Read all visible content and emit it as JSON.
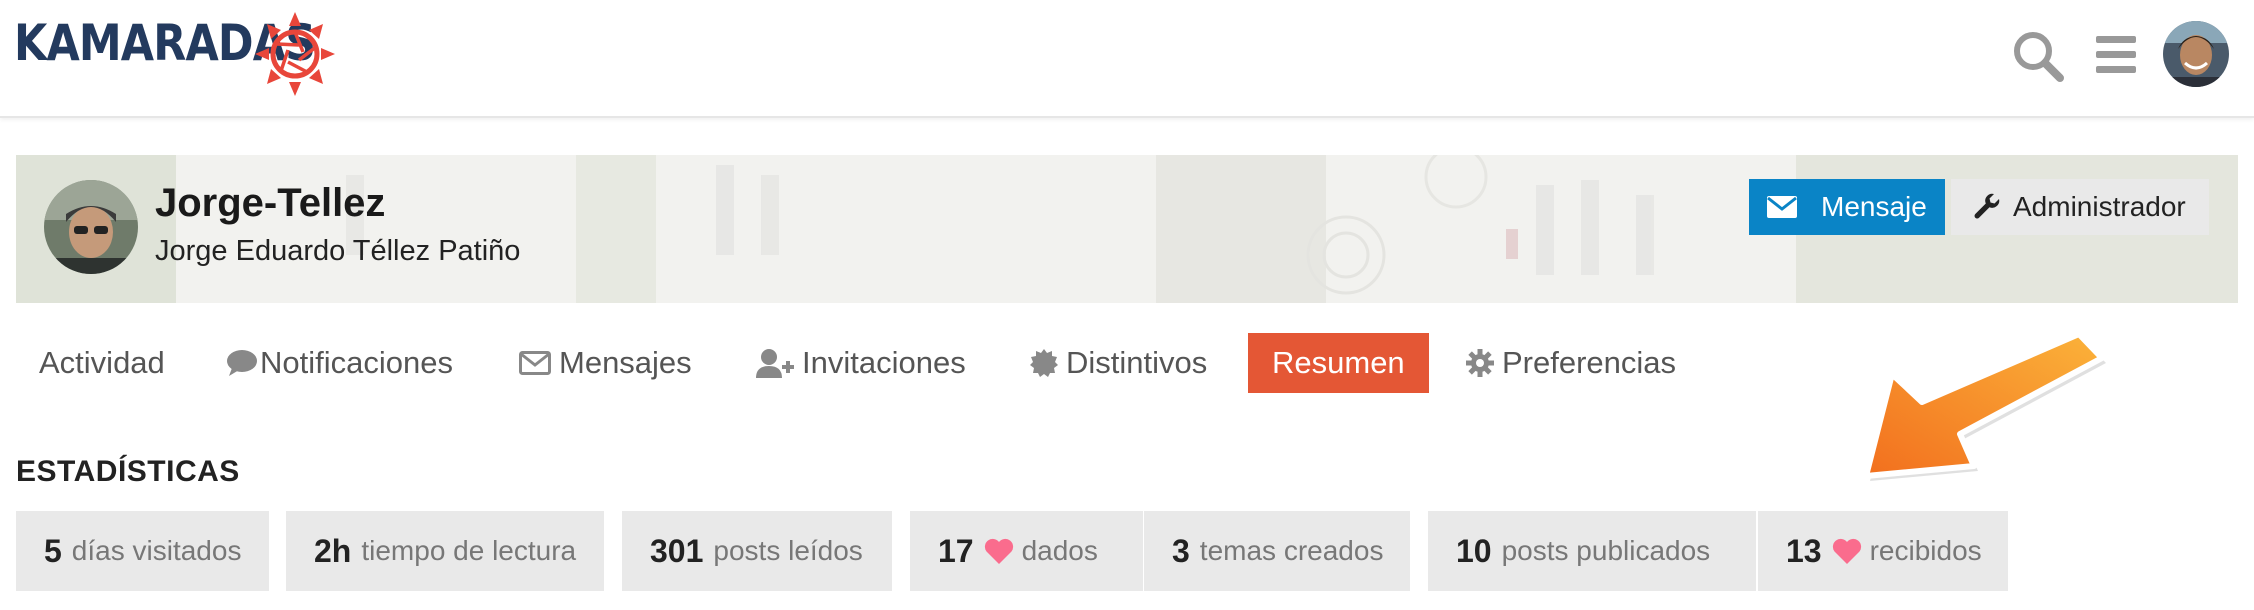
{
  "header": {
    "logo_text": "KAMARADAS",
    "icons": [
      "search-icon",
      "hamburger-menu-icon",
      "user-avatar"
    ]
  },
  "profile": {
    "username": "Jorge-Tellez",
    "full_name": "Jorge Eduardo Téllez Patiño",
    "message_button": "Mensaje",
    "admin_button": "Administrador"
  },
  "nav": {
    "items": [
      {
        "label": "Actividad",
        "icon": ""
      },
      {
        "label": "Notificaciones",
        "icon": "comment-icon"
      },
      {
        "label": "Mensajes",
        "icon": "envelope-icon"
      },
      {
        "label": "Invitaciones",
        "icon": "user-plus-icon"
      },
      {
        "label": "Distintivos",
        "icon": "badge-icon"
      },
      {
        "label": "Resumen",
        "icon": "",
        "active": true
      },
      {
        "label": "Preferencias",
        "icon": "gear-icon"
      }
    ]
  },
  "stats": {
    "title": "ESTADÍSTICAS",
    "items": [
      {
        "value": "5",
        "label": "días visitados"
      },
      {
        "value": "2h",
        "label": "tiempo de lectura"
      },
      {
        "value": "301",
        "label": "posts leídos"
      },
      {
        "value": "17",
        "label": "dados",
        "icon": "heart-icon"
      },
      {
        "value": "3",
        "label": "temas creados"
      },
      {
        "value": "10",
        "label": "posts publicados"
      },
      {
        "value": "13",
        "label": "recibidos",
        "icon": "heart-icon"
      }
    ]
  },
  "colors": {
    "brand_navy": "#233a5e",
    "brand_red": "#e8463a",
    "primary_blue": "#0a84c6",
    "active_tab": "#e45735",
    "heart": "#fa6c8d",
    "annotation_arrow": "#f7901e"
  }
}
